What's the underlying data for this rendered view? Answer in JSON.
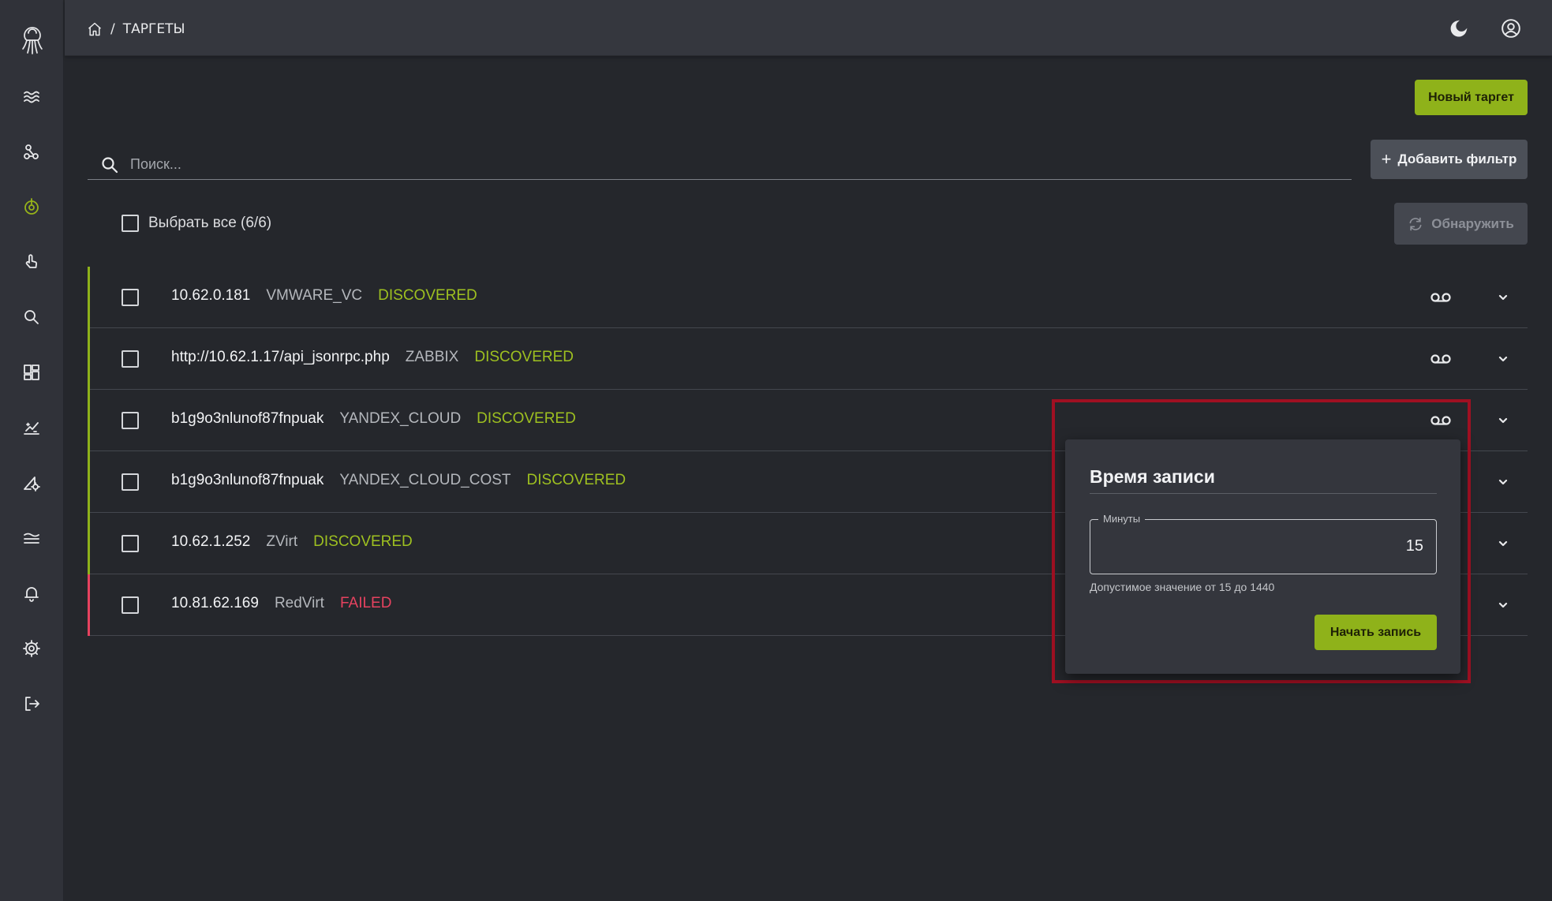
{
  "breadcrumb": {
    "separator": "/",
    "current": "ТАРГЕТЫ"
  },
  "actions": {
    "new_target": "Новый таргет",
    "add_filter": "Добавить фильтр",
    "add_filter_icon": "+",
    "discover": "Обнаружить"
  },
  "search": {
    "placeholder": "Поиск..."
  },
  "select_all": {
    "label": "Выбрать все (6/6)"
  },
  "targets": [
    {
      "name": "10.62.0.181",
      "type": "VMWARE_VC",
      "status": "DISCOVERED"
    },
    {
      "name": "http://10.62.1.17/api_jsonrpc.php",
      "type": "ZABBIX",
      "status": "DISCOVERED"
    },
    {
      "name": "b1g9o3nlunof87fnpuak",
      "type": "YANDEX_CLOUD",
      "status": "DISCOVERED"
    },
    {
      "name": "b1g9o3nlunof87fnpuak",
      "type": "YANDEX_CLOUD_COST",
      "status": "DISCOVERED"
    },
    {
      "name": "10.62.1.252",
      "type": "ZVirt",
      "status": "DISCOVERED"
    },
    {
      "name": "10.81.62.169",
      "type": "RedVirt",
      "status": "FAILED"
    }
  ],
  "popup": {
    "title": "Время записи",
    "field_label": "Минуты",
    "field_value": "15",
    "hint": "Допустимое значение от 15 до 1440",
    "start_button": "Начать запись"
  },
  "colors": {
    "accent": "#8fb21a",
    "status_ok": "#9ec020",
    "status_fail": "#e6425f",
    "highlight": "#a01022"
  },
  "icons": {
    "sidebar": [
      "logo-icon",
      "events-icon",
      "topology-icon",
      "targets-icon",
      "touch-icon",
      "search-icon",
      "dashboard-icon",
      "analytics-icon",
      "tools-icon",
      "streams-icon",
      "bell-icon",
      "settings-icon",
      "logout-icon"
    ],
    "header": [
      "home-icon",
      "moon-icon",
      "account-icon"
    ]
  }
}
